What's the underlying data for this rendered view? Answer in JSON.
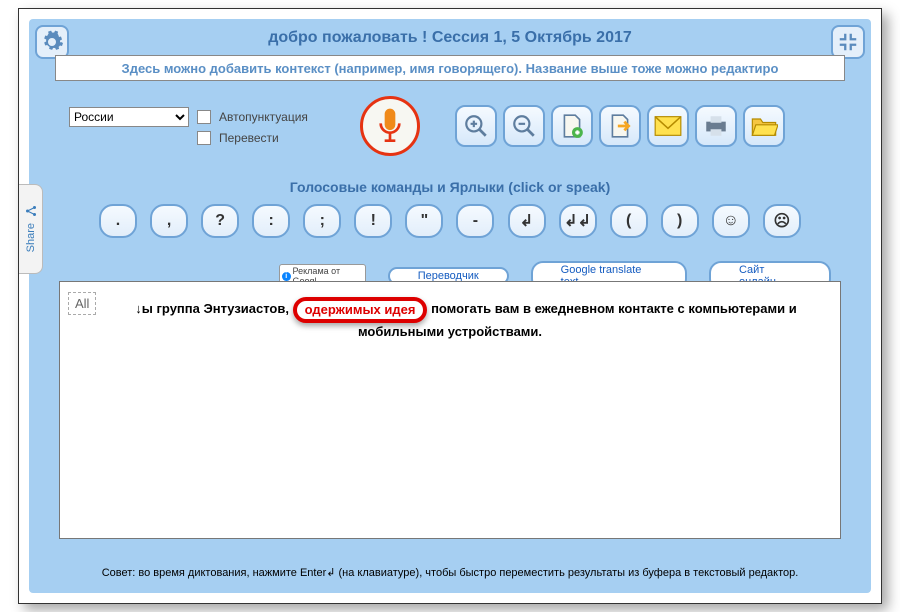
{
  "title": "добро пожаловать !   Сессия 1, 5 Октябрь 2017",
  "subtitle": "Здесь можно добавить контекст (например, имя говорящего). Название выше тоже можно редактиро",
  "language": {
    "selected": "России"
  },
  "checkboxes": {
    "autopunct": "Автопунктуация",
    "translate": "Перевести"
  },
  "voice_header": "Голосовые команды и Ярлыки (click or speak)",
  "punct": {
    "dot": ".",
    "comma": ",",
    "question": "?",
    "colon": ":",
    "semicolon": ";",
    "exclaim": "!",
    "quote": "\"",
    "dash": "-",
    "enter1": "↲",
    "enter2": "↲↲",
    "paren_open": "(",
    "paren_close": ")",
    "smile": "☺",
    "sad": "☹"
  },
  "links": {
    "ad_label": "Реклама от Googl",
    "translator": "Переводчик",
    "google_translate": "Google translate text",
    "site": "Сайт онлайн"
  },
  "editor": {
    "all": "All",
    "before": "ы группа Энтузиастов, ",
    "circled": "одержимых идея",
    "after1": " помогать вам в ежедневном контакте с компьютерами и",
    "line2": "мобильными устройствами."
  },
  "tip": "Совет: во время диктования, нажмите Enter↲ (на клавиатуре), чтобы быстро переместить результаты из буфера в текстовый редактор.",
  "share": "Share"
}
